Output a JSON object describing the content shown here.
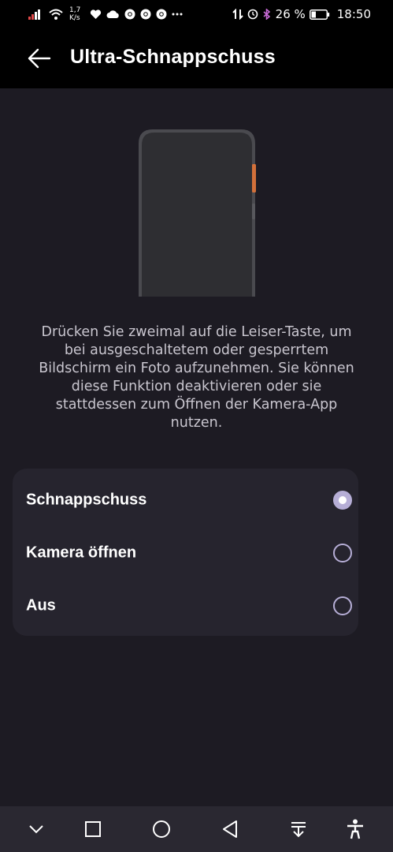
{
  "status_bar": {
    "net_speed_value": "1,7",
    "net_speed_unit": "K/s",
    "battery": "26 %",
    "time": "18:50"
  },
  "app_bar": {
    "title": "Ultra-Schnappschuss"
  },
  "description": "Drücken Sie zweimal auf die Leiser-Taste, um bei ausgeschaltetem oder gesperrtem Bildschirm ein Foto aufzunehmen. Sie können diese Funktion deaktivieren oder sie stattdessen zum Öffnen der Kamera-App nutzen.",
  "options": [
    {
      "label": "Schnappschuss",
      "selected": true
    },
    {
      "label": "Kamera öffnen",
      "selected": false
    },
    {
      "label": "Aus",
      "selected": false
    }
  ],
  "colors": {
    "accent": "#b6aed6",
    "background": "#1d1b23",
    "card": "#26242e",
    "volume_button": "#d2703a"
  }
}
